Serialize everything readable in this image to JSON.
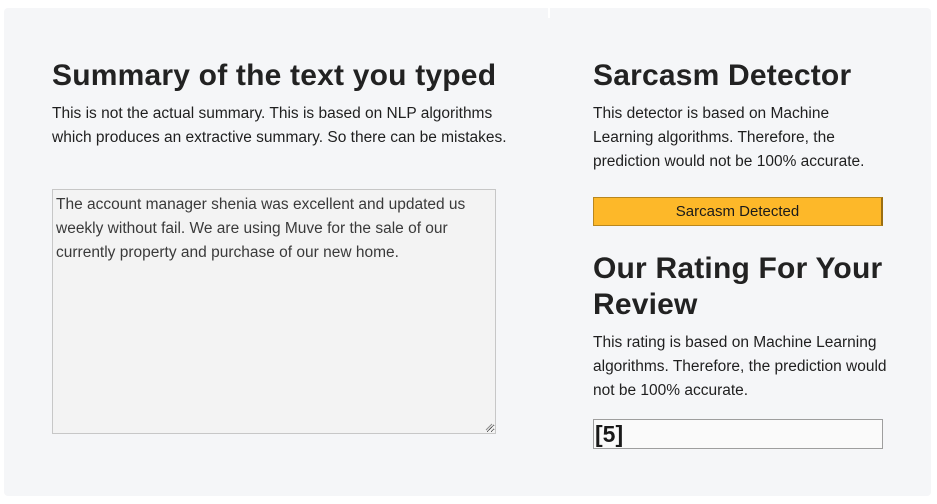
{
  "summary": {
    "title": "Summary of the text you typed",
    "description": "This is not the actual summary. This is based on NLP algorithms which produces an extractive summary. So there can be mistakes.",
    "text": "The account manager shenia was excellent and updated us weekly without fail. We are using Muve for the sale of our currently property and purchase of our new home."
  },
  "sarcasm": {
    "title": "Sarcasm Detector",
    "description": "This detector is based on Machine Learning algorithms. Therefore, the prediction would not be 100% accurate.",
    "result": "Sarcasm Detected",
    "result_color": "#fdb829"
  },
  "rating": {
    "title": "Our Rating For Your Review",
    "description": "This rating is based on Machine Learning algorithms. Therefore, the prediction would not be 100% accurate.",
    "value": "[5]"
  }
}
